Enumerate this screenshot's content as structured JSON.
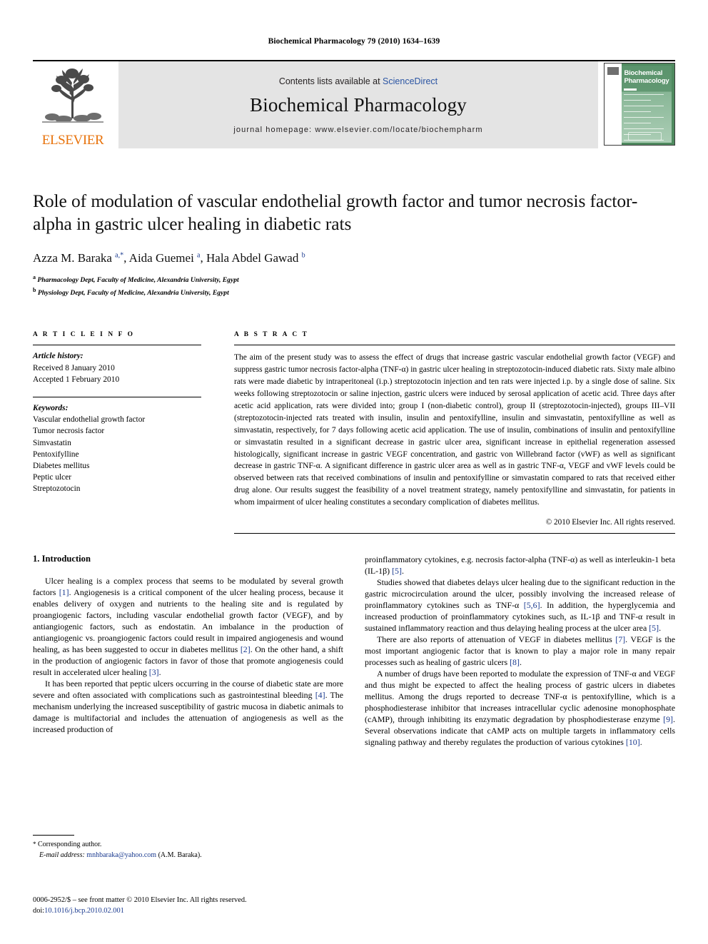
{
  "running_head": "Biochemical Pharmacology 79 (2010) 1634–1639",
  "masthead": {
    "publisher_name": "ELSEVIER",
    "contents_prefix": "Contents lists available at ",
    "contents_link": "ScienceDirect",
    "journal_title": "Biochemical Pharmacology",
    "homepage": "journal homepage: www.elsevier.com/locate/biochempharm",
    "cover_title_line1": "Biochemical",
    "cover_title_line2": "Pharmacology"
  },
  "article": {
    "title": "Role of modulation of vascular endothelial growth factor and tumor necrosis factor-alpha in gastric ulcer healing in diabetic rats",
    "authors_html": "Azza M. Baraka <sup>a,*</sup>, Aida Guemei <sup>a</sup>, Hala Abdel Gawad <sup>b</sup>",
    "affiliation_a": "Pharmacology Dept, Faculty of Medicine, Alexandria University, Egypt",
    "affiliation_b": "Physiology Dept, Faculty of Medicine, Alexandria University, Egypt"
  },
  "info": {
    "heading": "A R T I C L E   I N F O",
    "history_label": "Article history:",
    "received": "Received 8 January 2010",
    "accepted": "Accepted 1 February 2010",
    "keywords_label": "Keywords:",
    "keywords": [
      "Vascular endothelial growth factor",
      "Tumor necrosis factor",
      "Simvastatin",
      "Pentoxifylline",
      "Diabetes mellitus",
      "Peptic ulcer",
      "Streptozotocin"
    ]
  },
  "abstract": {
    "heading": "A B S T R A C T",
    "text": "The aim of the present study was to assess the effect of drugs that increase gastric vascular endothelial growth factor (VEGF) and suppress gastric tumor necrosis factor-alpha (TNF-α) in gastric ulcer healing in streptozotocin-induced diabetic rats. Sixty male albino rats were made diabetic by intraperitoneal (i.p.) streptozotocin injection and ten rats were injected i.p. by a single dose of saline. Six weeks following streptozotocin or saline injection, gastric ulcers were induced by serosal application of acetic acid. Three days after acetic acid application, rats were divided into; group I (non-diabetic control), group II (streptozotocin-injected), groups III–VII (streptozotocin-injected rats treated with insulin, insulin and pentoxifylline, insulin and simvastatin, pentoxifylline as well as simvastatin, respectively, for 7 days following acetic acid application. The use of insulin, combinations of insulin and pentoxifylline or simvastatin resulted in a significant decrease in gastric ulcer area, significant increase in epithelial regeneration assessed histologically, significant increase in gastric VEGF concentration, and gastric von Willebrand factor (vWF) as well as significant decrease in gastric TNF-α. A significant difference in gastric ulcer area as well as in gastric TNF-α, VEGF and vWF levels could be observed between rats that received combinations of insulin and pentoxifylline or simvastatin compared to rats that received either drug alone. Our results suggest the feasibility of a novel treatment strategy, namely pentoxifylline and simvastatin, for patients in whom impairment of ulcer healing constitutes a secondary complication of diabetes mellitus.",
    "copyright": "© 2010 Elsevier Inc. All rights reserved."
  },
  "introduction": {
    "heading": "1. Introduction",
    "left_paragraphs": [
      "Ulcer healing is a complex process that seems to be modulated by several growth factors [1]. Angiogenesis is a critical component of the ulcer healing process, because it enables delivery of oxygen and nutrients to the healing site and is regulated by proangiogenic factors, including vascular endothelial growth factor (VEGF), and by antiangiogenic factors, such as endostatin. An imbalance in the production of antiangiogenic vs. proangiogenic factors could result in impaired angiogenesis and wound healing, as has been suggested to occur in diabetes mellitus [2]. On the other hand, a shift in the production of angiogenic factors in favor of those that promote angiogenesis could result in accelerated ulcer healing [3].",
      "It has been reported that peptic ulcers occurring in the course of diabetic state are more severe and often associated with complications such as gastrointestinal bleeding [4]. The mechanism underlying the increased susceptibility of gastric mucosa in diabetic animals to damage is multifactorial and includes the attenuation of angiogenesis as well as the increased production of"
    ],
    "right_paragraphs": [
      "proinflammatory cytokines, e.g. necrosis factor-alpha (TNF-α) as well as interleukin-1 beta (IL-1β) [5].",
      "Studies showed that diabetes delays ulcer healing due to the significant reduction in the gastric microcirculation around the ulcer, possibly involving the increased release of proinflammatory cytokines such as TNF-α [5,6]. In addition, the hyperglycemia and increased production of proinflammatory cytokines such, as IL-1β and TNF-α result in sustained inflammatory reaction and thus delaying healing process at the ulcer area [5].",
      "There are also reports of attenuation of VEGF in diabetes mellitus [7]. VEGF is the most important angiogenic factor that is known to play a major role in many repair processes such as healing of gastric ulcers [8].",
      "A number of drugs have been reported to modulate the expression of TNF-α and VEGF and thus might be expected to affect the healing process of gastric ulcers in diabetes mellitus. Among the drugs reported to decrease TNF-α is pentoxifylline, which is a phosphodiesterase inhibitor that increases intracellular cyclic adenosine monophosphate (cAMP), through inhibiting its enzymatic degradation by phosphodiesterase enzyme [9]. Several observations indicate that cAMP acts on multiple targets in inflammatory cells signaling pathway and thereby regulates the production of various cytokines [10]."
    ]
  },
  "footnote": {
    "corresponding": "Corresponding author.",
    "email_label": "E-mail address:",
    "email": "mnhbaraka@yahoo.com",
    "email_owner": "(A.M. Baraka)."
  },
  "page_footer": {
    "front_matter": "0006-2952/$ – see front matter © 2010 Elsevier Inc. All rights reserved.",
    "doi_label": "doi:",
    "doi_value": "10.1016/j.bcp.2010.02.001"
  },
  "colors": {
    "elsevier_orange": "#E8730C",
    "link_blue": "#2b55a3",
    "ref_blue": "#1a3a8f",
    "band_gray": "#e4e4e4",
    "cover_green": "#4f8a5f"
  }
}
